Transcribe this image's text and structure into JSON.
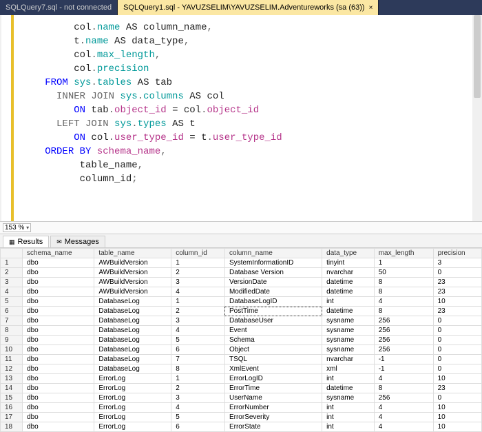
{
  "tabs": [
    {
      "label": "SQLQuery7.sql - not connected",
      "active": false
    },
    {
      "label": "SQLQuery1.sql - YAVUZSELIM\\YAVUZSELIM.Adventureworks (sa (63))",
      "active": true,
      "close": "×"
    }
  ],
  "zoom": {
    "value": "153 %"
  },
  "result_tabs": {
    "results": "Results",
    "messages": "Messages"
  },
  "code": {
    "l1a": "col",
    "l1b": ".",
    "l1c": "name",
    "l1d": " AS column_name",
    "l2a": "t",
    "l2b": ".",
    "l2c": "name",
    "l2d": " AS data_type",
    "l3a": "col",
    "l3b": ".",
    "l3c": "max_length",
    "l4a": "col",
    "l4b": ".",
    "l4c": "precision",
    "l5a": "FROM",
    "l5b": " sys",
    "l5c": ".",
    "l5d": "tables",
    "l5e": " AS tab",
    "l6a": "INNER JOIN",
    "l6b": " sys",
    "l6c": ".",
    "l6d": "columns",
    "l6e": " AS col",
    "l7a": "ON",
    "l7b": " tab",
    "l7c": ".",
    "l7d": "object_id",
    "l7e": " = col",
    "l7f": ".",
    "l7g": "object_id",
    "l8a": "LEFT JOIN",
    "l8b": " sys",
    "l8c": ".",
    "l8d": "types",
    "l8e": " AS t",
    "l9a": "ON",
    "l9b": " col",
    "l9c": ".",
    "l9d": "user_type_id",
    "l9e": " = t",
    "l9f": ".",
    "l9g": "user_type_id",
    "l10a": "ORDER BY",
    "l10b": " schema_name",
    "l11a": "table_name",
    "l12a": "column_id",
    "comma": ",",
    "semi": ";"
  },
  "grid": {
    "headers": [
      "schema_name",
      "table_name",
      "column_id",
      "column_name",
      "data_type",
      "max_length",
      "precision"
    ],
    "rows": [
      [
        "dbo",
        "AWBuildVersion",
        "1",
        "SystemInformationID",
        "tinyint",
        "1",
        "3"
      ],
      [
        "dbo",
        "AWBuildVersion",
        "2",
        "Database Version",
        "nvarchar",
        "50",
        "0"
      ],
      [
        "dbo",
        "AWBuildVersion",
        "3",
        "VersionDate",
        "datetime",
        "8",
        "23"
      ],
      [
        "dbo",
        "AWBuildVersion",
        "4",
        "ModifiedDate",
        "datetime",
        "8",
        "23"
      ],
      [
        "dbo",
        "DatabaseLog",
        "1",
        "DatabaseLogID",
        "int",
        "4",
        "10"
      ],
      [
        "dbo",
        "DatabaseLog",
        "2",
        "PostTime",
        "datetime",
        "8",
        "23"
      ],
      [
        "dbo",
        "DatabaseLog",
        "3",
        "DatabaseUser",
        "sysname",
        "256",
        "0"
      ],
      [
        "dbo",
        "DatabaseLog",
        "4",
        "Event",
        "sysname",
        "256",
        "0"
      ],
      [
        "dbo",
        "DatabaseLog",
        "5",
        "Schema",
        "sysname",
        "256",
        "0"
      ],
      [
        "dbo",
        "DatabaseLog",
        "6",
        "Object",
        "sysname",
        "256",
        "0"
      ],
      [
        "dbo",
        "DatabaseLog",
        "7",
        "TSQL",
        "nvarchar",
        "-1",
        "0"
      ],
      [
        "dbo",
        "DatabaseLog",
        "8",
        "XmlEvent",
        "xml",
        "-1",
        "0"
      ],
      [
        "dbo",
        "ErrorLog",
        "1",
        "ErrorLogID",
        "int",
        "4",
        "10"
      ],
      [
        "dbo",
        "ErrorLog",
        "2",
        "ErrorTime",
        "datetime",
        "8",
        "23"
      ],
      [
        "dbo",
        "ErrorLog",
        "3",
        "UserName",
        "sysname",
        "256",
        "0"
      ],
      [
        "dbo",
        "ErrorLog",
        "4",
        "ErrorNumber",
        "int",
        "4",
        "10"
      ],
      [
        "dbo",
        "ErrorLog",
        "5",
        "ErrorSeverity",
        "int",
        "4",
        "10"
      ],
      [
        "dbo",
        "ErrorLog",
        "6",
        "ErrorState",
        "int",
        "4",
        "10"
      ]
    ],
    "selected": {
      "row": 5,
      "col": 3
    }
  }
}
